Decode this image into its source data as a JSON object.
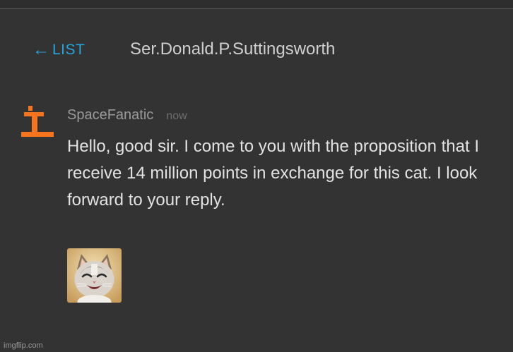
{
  "header": {
    "back_arrow": "←",
    "back_label": "LIST",
    "thread_title": "Ser.Donald.P.Suttingsworth",
    "accent_color": "#24a6dc"
  },
  "message": {
    "avatar_icon": "orange-cross-icon",
    "avatar_color": "#f7741e",
    "username": "SpaceFanatic",
    "timestamp": "now",
    "body": "Hello, good sir. I come to you with the proposition that I receive 14 million points in exchange for this cat. I look forward to your reply.",
    "attachment_icon": "smiling-cat-image"
  },
  "watermark": "imgflip.com"
}
